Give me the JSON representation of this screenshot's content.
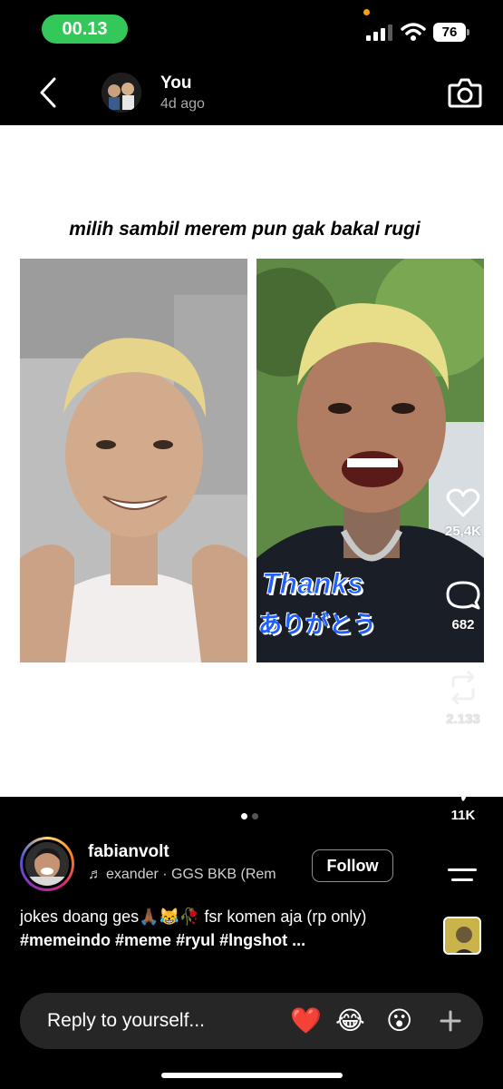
{
  "status_bar": {
    "time": "00.13",
    "battery": "76"
  },
  "header": {
    "name": "You",
    "time_ago": "4d ago"
  },
  "media": {
    "caption": "milih sambil merem pun gak bakal rugi",
    "sticker_en": "Thanks",
    "sticker_jp": "ありがとう"
  },
  "actions": {
    "likes": "25,4K",
    "comments": "682",
    "reposts": "2.133",
    "shares": "11K"
  },
  "author": {
    "username": "fabianvolt",
    "music": "exander · GGS BKB (Rem",
    "follow_label": "Follow"
  },
  "caption": {
    "text_line": "jokes doang ges🙏🏾😹🥀 fsr komen aja (rp only)",
    "tags": "#memeindo #meme #ryul #lngshot ..."
  },
  "reply": {
    "placeholder": "Reply to yourself...",
    "reactions": [
      "❤️",
      "😂",
      "😮"
    ]
  },
  "colors": {
    "time_pill": "#34c759",
    "background": "#000000",
    "reply_bar": "#262626",
    "sticker_blue": "#1f5fff"
  }
}
